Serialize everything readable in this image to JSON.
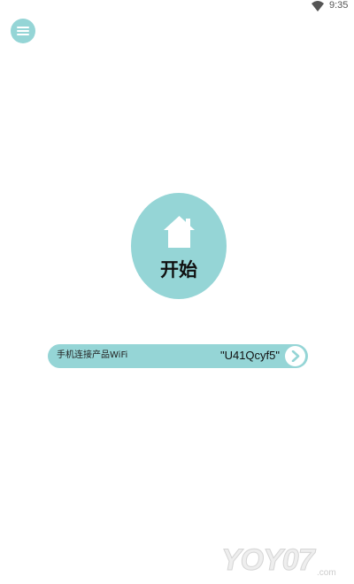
{
  "colors": {
    "accent": "#95d5d6"
  },
  "status_bar": {
    "time": "9:35",
    "wifi_icon": "wifi-icon"
  },
  "menu": {
    "icon": "menu-icon"
  },
  "start": {
    "label": "开始",
    "icon": "home-icon"
  },
  "wifi_bar": {
    "label": "手机连接产品WiFi",
    "ssid": "\"U41Qcyf5\"",
    "icon": "chevron-right-icon"
  },
  "watermark": {
    "text": "YOY07.com"
  }
}
